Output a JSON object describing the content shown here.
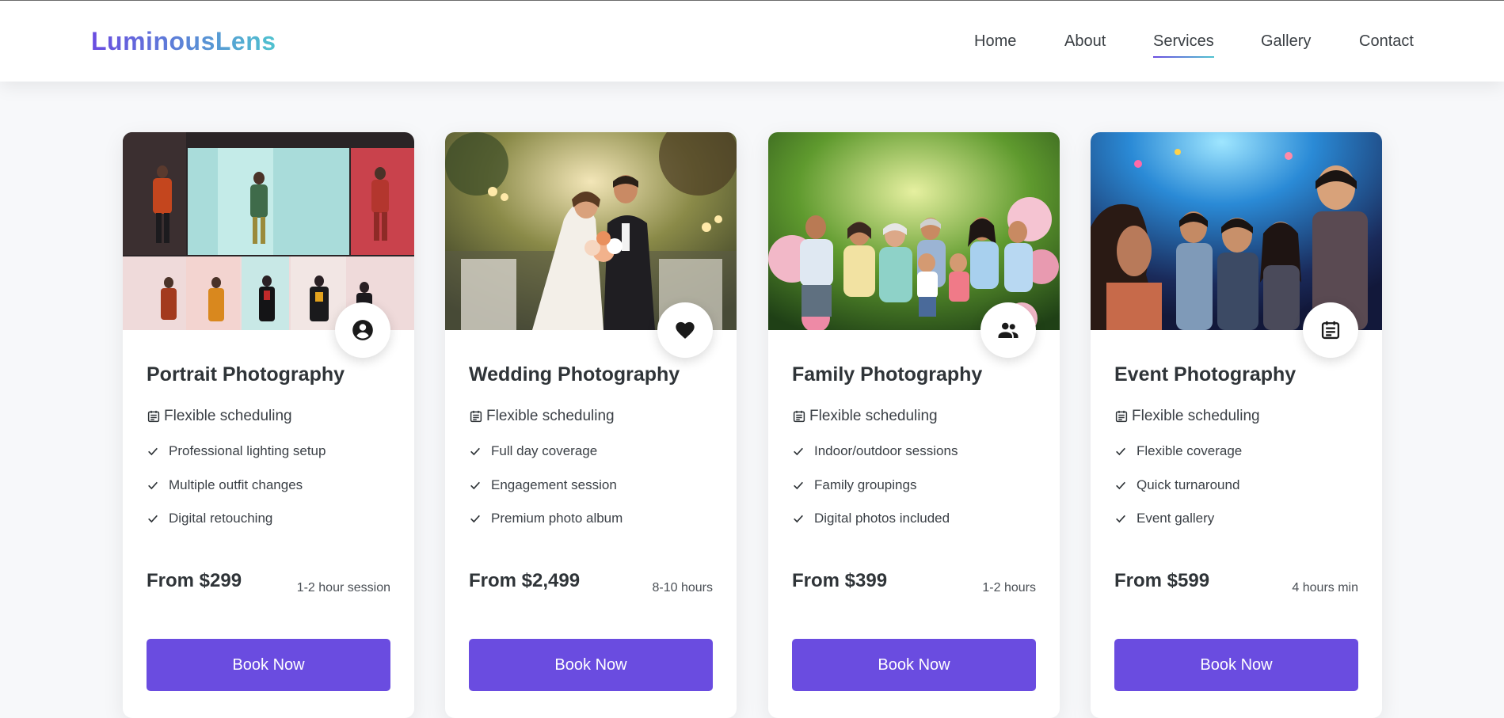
{
  "brand": {
    "logo": "LuminousLens"
  },
  "nav": {
    "items": [
      {
        "label": "Home"
      },
      {
        "label": "About"
      },
      {
        "label": "Services",
        "active": true
      },
      {
        "label": "Gallery"
      },
      {
        "label": "Contact"
      }
    ]
  },
  "colors": {
    "accent": "#6a4ce0",
    "gradient_end": "#4fc3cf",
    "text": "#2f3438",
    "background": "#f7f8fa"
  },
  "services": [
    {
      "title": "Portrait Photography",
      "icon": "person-circle-icon",
      "image": "portrait-studio-photo",
      "schedule": "Flexible scheduling",
      "features": [
        "Professional lighting setup",
        "Multiple outfit changes",
        "Digital retouching"
      ],
      "price": "From $299",
      "duration": "1-2 hour session",
      "button": "Book Now"
    },
    {
      "title": "Wedding Photography",
      "icon": "heart-icon",
      "image": "wedding-couple-photo",
      "schedule": "Flexible scheduling",
      "features": [
        "Full day coverage",
        "Engagement session",
        "Premium photo album"
      ],
      "price": "From $2,499",
      "duration": "8-10 hours",
      "button": "Book Now"
    },
    {
      "title": "Family Photography",
      "icon": "people-icon",
      "image": "family-garden-photo",
      "schedule": "Flexible scheduling",
      "features": [
        "Indoor/outdoor sessions",
        "Family groupings",
        "Digital photos included"
      ],
      "price": "From $399",
      "duration": "1-2 hours",
      "button": "Book Now"
    },
    {
      "title": "Event Photography",
      "icon": "event-calendar-icon",
      "image": "event-crowd-photo",
      "schedule": "Flexible scheduling",
      "features": [
        "Flexible coverage",
        "Quick turnaround",
        "Event gallery"
      ],
      "price": "From $599",
      "duration": "4 hours min",
      "button": "Book Now"
    }
  ]
}
